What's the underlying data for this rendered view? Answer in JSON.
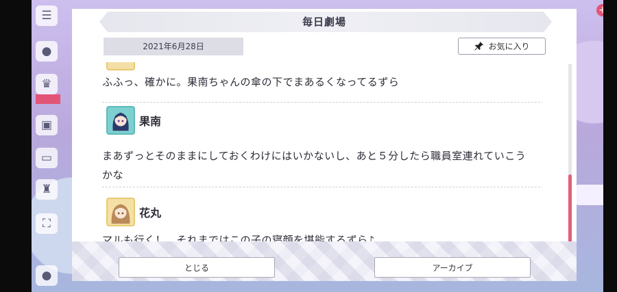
{
  "dialog": {
    "title": "毎日劇場",
    "date": "2021年6月28日",
    "favorite_label": "お気に入り"
  },
  "conversation": [
    {
      "speaker": "",
      "text": "ふふっ、確かに。果南ちゃんの傘の下でまあるくなってるずら"
    },
    {
      "speaker": "果南",
      "lines": [
        "まあずっとそのままにしておくわけにはいかないし、あと５分したら職員室連れていこう",
        "かな"
      ]
    },
    {
      "speaker": "花丸",
      "text": "マルも行く！　それまではこの子の寝顔を堪能するずら♪"
    }
  ],
  "footer": {
    "close_label": "とじる",
    "archive_label": "アーカイブ"
  },
  "scroll": {
    "position_fraction": 1.0
  },
  "colors": {
    "accent": "#e35d7b",
    "header": "#e6e6ee",
    "date_bg": "#dddde6"
  },
  "icons": {
    "favorite": "pin-icon"
  }
}
